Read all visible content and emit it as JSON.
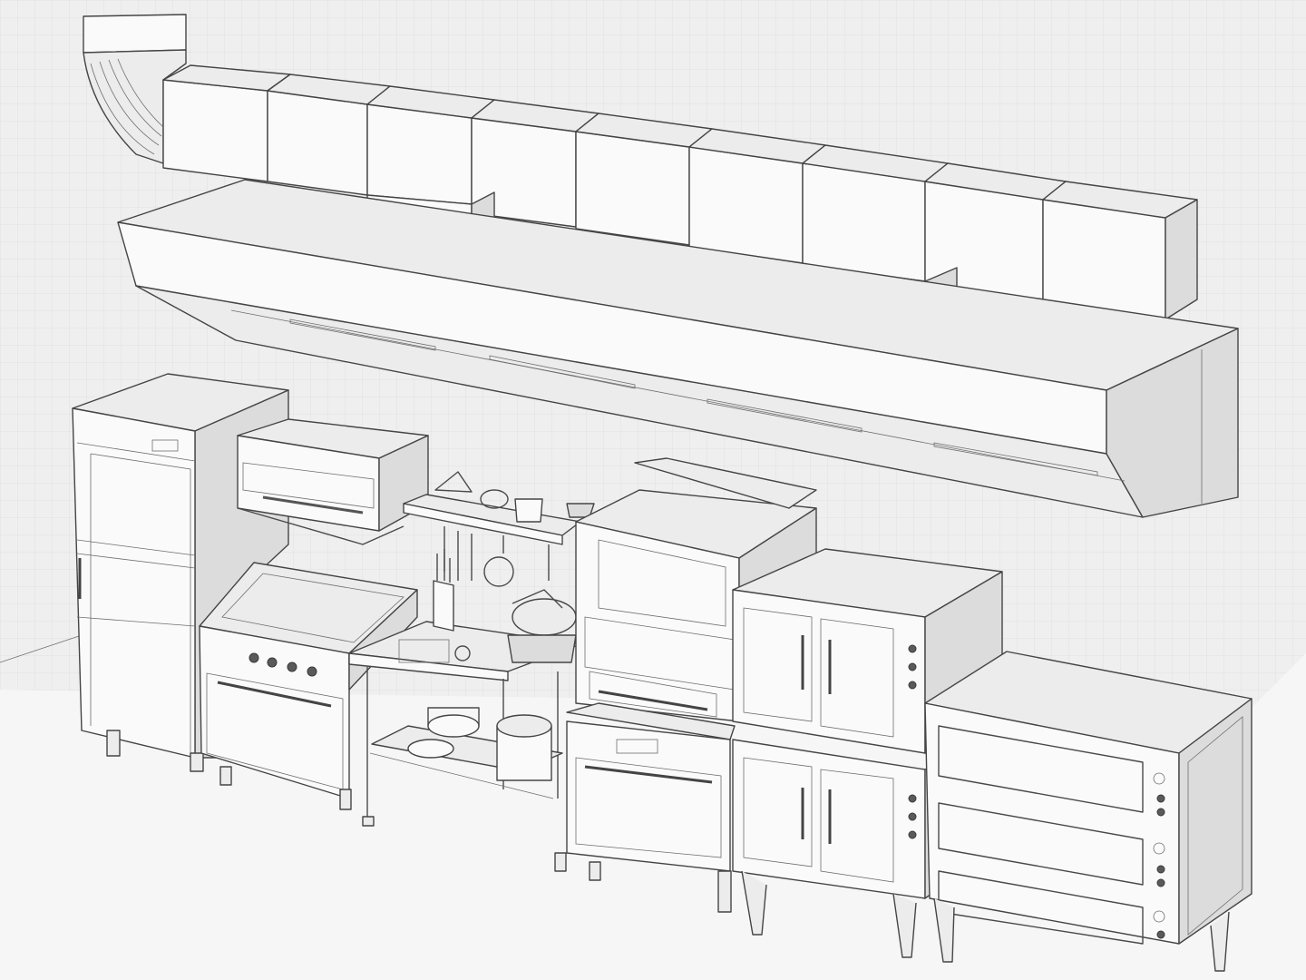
{
  "scene": {
    "subject": "",
    "colors": {
      "background": "#f2f2f2",
      "wall": "#efefef",
      "floor": "#f6f6f6",
      "line": "#454545",
      "face_light": "#fafafa",
      "face_mid": "#ececec",
      "face_dark": "#dcdcdc"
    }
  }
}
